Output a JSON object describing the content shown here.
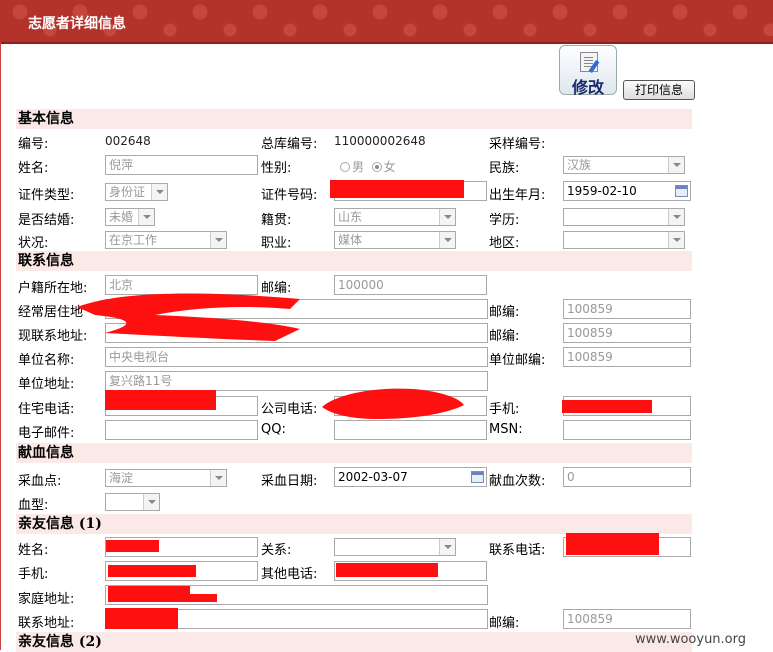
{
  "page_title": "志愿者详细信息",
  "buttons": {
    "edit": "修改",
    "print": "打印信息"
  },
  "basic": {
    "section": "基本信息",
    "id_label": "编号:",
    "id_value": "002648",
    "db_label": "总库编号:",
    "db_value": "110000002648",
    "sample_label": "采样编号:",
    "name_label": "姓名:",
    "name_value": "倪萍",
    "gender_label": "性别:",
    "gender_male": "男",
    "gender_female": "女",
    "ethnic_label": "民族:",
    "ethnic_value": "汉族",
    "idtype_label": "证件类型:",
    "idtype_value": "身份证",
    "idno_label": "证件号码:",
    "birth_label": "出生年月:",
    "birth_value": "1959-02-10",
    "married_label": "是否结婚:",
    "married_value": "未婚",
    "origin_label": "籍贯:",
    "origin_value": "山东",
    "edu_label": "学历:",
    "status_label": "状况:",
    "status_value": "在京工作",
    "job_label": "职业:",
    "job_value": "媒体",
    "area_label": "地区:"
  },
  "contact": {
    "section": "联系信息",
    "hukou_label": "户籍所在地:",
    "hukou_value": "北京",
    "zip_label": "邮编:",
    "zip1_value": "100000",
    "addr_label": "经常居住地",
    "zip2_value": "100859",
    "curaddr_label": "现联系地址:",
    "zip3_value": "100859",
    "org_label": "单位名称:",
    "org_value": "中央电视台",
    "orgzip_label": "单位邮编:",
    "orgzip_value": "100859",
    "orgaddr_label": "单位地址:",
    "orgaddr_value": "复兴路11号",
    "home_label": "住宅电话:",
    "work_label": "公司电话:",
    "mobile_label": "手机:",
    "email_label": "电子邮件:",
    "qq_label": "QQ:",
    "msn_label": "MSN:"
  },
  "donation": {
    "section": "献血信息",
    "site_label": "采血点:",
    "site_value": "海淀",
    "date_label": "采血日期:",
    "date_value": "2002-03-07",
    "count_label": "献血次数:",
    "count_value": "0",
    "blood_label": "血型:"
  },
  "relative1": {
    "section": "亲友信息 (1)",
    "name_label": "姓名:",
    "rel_label": "关系:",
    "phone_label": "联系电话:",
    "mobile_label": "手机:",
    "other_label": "其他电话:",
    "home_label": "家庭地址:",
    "addr_label": "联系地址:",
    "zip_label": "邮编:",
    "zip_value": "100859"
  },
  "relative2": {
    "section": "亲友信息 (2)"
  },
  "watermark": "www.wooyun.org"
}
